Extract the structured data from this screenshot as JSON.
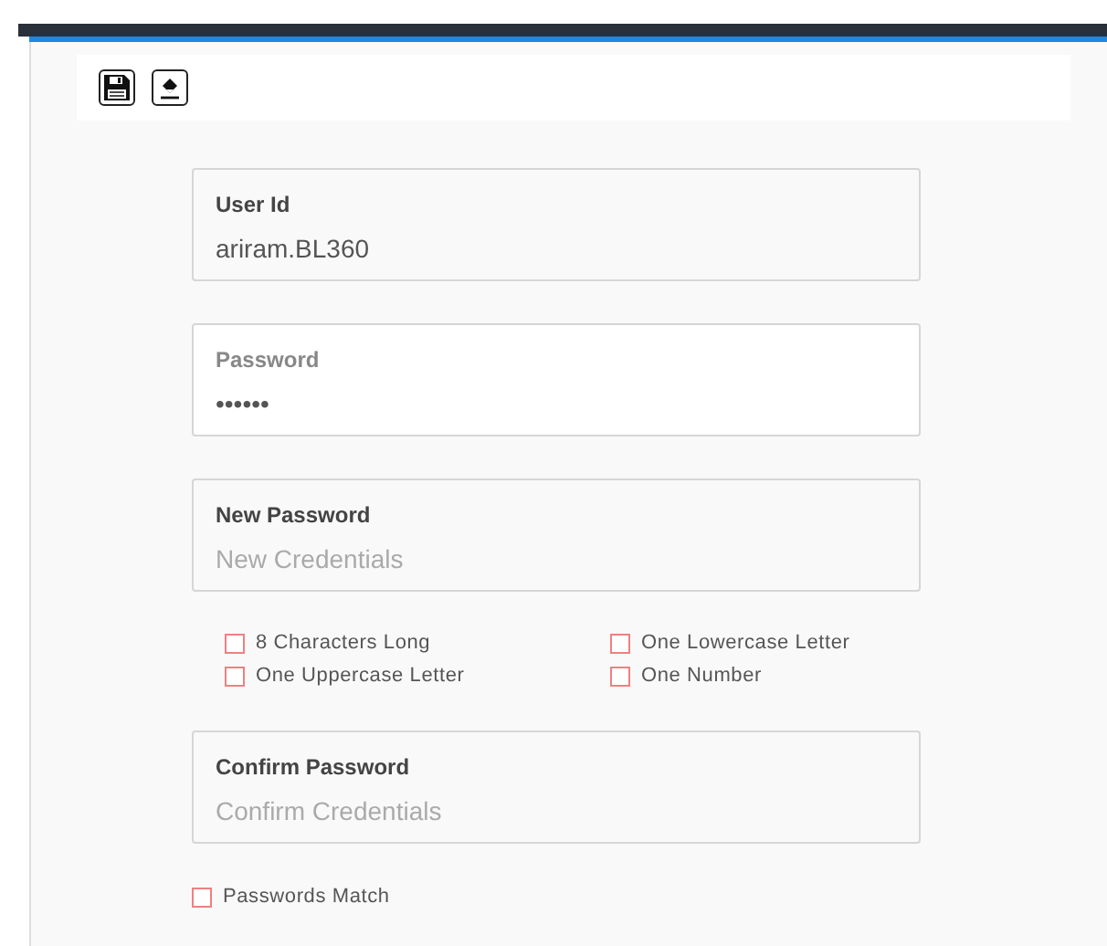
{
  "toolbar": {
    "buttons": [
      {
        "kind": "save"
      },
      {
        "kind": "clear"
      }
    ]
  },
  "fields": [
    {
      "label": "User Id",
      "value": "ariram.BL360",
      "focused": false
    },
    {
      "label": "Password",
      "value": "••••••",
      "focused": true
    },
    {
      "label": "New Password",
      "placeholder": "New Credentials",
      "focused": false
    }
  ],
  "requirements": [
    {
      "label": "8 Characters Long",
      "checked": false
    },
    {
      "label": "One Lowercase Letter",
      "checked": false
    },
    {
      "label": "One Uppercase Letter",
      "checked": false
    },
    {
      "label": "One Number",
      "checked": false
    }
  ],
  "confirm": {
    "label": "Confirm Password",
    "placeholder": "Confirm Credentials",
    "focused": false
  },
  "match": {
    "label": "Passwords Match",
    "checked": false
  }
}
